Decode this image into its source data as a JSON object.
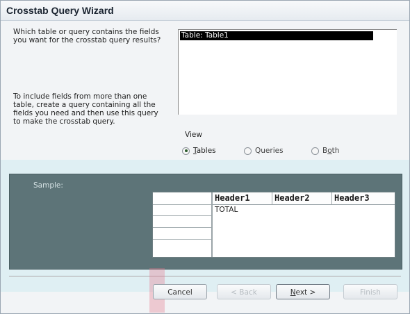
{
  "window": {
    "title": "Crosstab Query Wizard"
  },
  "instructions": {
    "question": "Which table or query contains the fields you want for the crosstab query results?",
    "hint": "To include fields from more than one table, create a query containing all the fields you need and then use this query to make the crosstab query."
  },
  "list": {
    "items": [
      "Table: Table1"
    ],
    "selected_index": 0
  },
  "view": {
    "label": "View",
    "options": [
      {
        "label": "Tables",
        "accel": "T",
        "checked": true
      },
      {
        "label": "Queries",
        "accel": "",
        "checked": false
      },
      {
        "label": "Both",
        "accel": "o",
        "checked": false
      }
    ]
  },
  "sample": {
    "label": "Sample:",
    "headers": [
      "Header1",
      "Header2",
      "Header3"
    ],
    "total_label": "TOTAL"
  },
  "buttons": {
    "cancel": "Cancel",
    "back": "< Back",
    "next": "Next >",
    "finish": "Finish"
  }
}
